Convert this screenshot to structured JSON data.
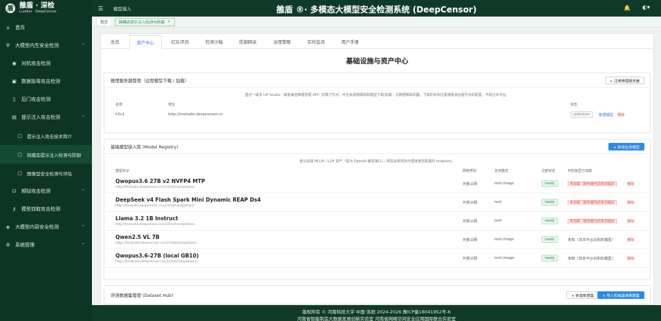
{
  "brand": {
    "name": "雒盾 · 深检",
    "sub": "Luodun · DeepCensor"
  },
  "topbar": {
    "breadcrumb": "模型接入",
    "system_title": "雒盾 ®· 多模态大模型安全检测系统 (DeepCensor)"
  },
  "sidebar": {
    "items": [
      {
        "label": "首页",
        "icon": "home-icon",
        "level": 1
      },
      {
        "label": "大模型内生安全检测",
        "icon": "shield-icon",
        "level": 1,
        "chev": "⌃"
      },
      {
        "label": "对抗攻击检测",
        "icon": "target-icon",
        "level": 2
      },
      {
        "label": "数据投毒攻击检测",
        "icon": "database-icon",
        "level": 2
      },
      {
        "label": "后门攻击检测",
        "icon": "door-icon",
        "level": 2
      },
      {
        "label": "提示注入攻击检测",
        "icon": "prompt-icon",
        "level": 2,
        "chev": "⌃"
      },
      {
        "label": "提示注入攻击技术简介",
        "icon": "doc-icon",
        "level": 3
      },
      {
        "label": "跨模态提示注入检测与防御",
        "icon": "doc-icon",
        "level": 3,
        "active": true
      },
      {
        "label": "图像型安全检测与评估",
        "icon": "doc-icon",
        "level": 3
      },
      {
        "label": "越狱攻击检测",
        "icon": "lock-icon",
        "level": 2,
        "chev": "⌃"
      },
      {
        "label": "模型窃取攻击检测",
        "icon": "key-icon",
        "level": 2
      },
      {
        "label": "大模型内容安全检测",
        "icon": "content-icon",
        "level": 1,
        "chev": "⌃"
      },
      {
        "label": "系统管理",
        "icon": "gear-icon",
        "level": 1,
        "chev": "⌃"
      }
    ]
  },
  "page_tabs": [
    {
      "label": "首页",
      "active": false
    },
    {
      "label": "跨模态提示注入检测与防御",
      "active": true
    }
  ],
  "subtabs": [
    "总览",
    "资产中心",
    "红队评测",
    "检测沙箱",
    "防御网关",
    "治理策略",
    "实时监测",
    "用户手册"
  ],
  "active_subtab": "资产中心",
  "page_title": "基础设施与资产中心",
  "inference": {
    "title": "推理服务器管理（远程模型下载 / 加载）",
    "btn": "+ 注册推理服务器",
    "note": "登记一或多 LM Studio（或者兼容推理管理 API）的算力节点，可在资源明细获取模型下载/加载、元数据等除机器。下载的实际位置遵循该远程节点的配置，不经过本平台。",
    "cols": [
      "名称",
      "地址",
      "状态"
    ],
    "rows": [
      {
        "name": "h5c1",
        "addr": "http://lmstudio.deepcensor.cn",
        "status": "unknown",
        "manage": "管理模型",
        "del": "删除"
      }
    ]
  },
  "registry": {
    "title": "基础模型接入库 (Model Registry)",
    "btn": "+ 新增业务模型",
    "note": "登记后端 MLLM / LLM 资产（需为 OpenAI 兼容接口）；网关会将实际代理连接至配置的 endpoint。",
    "cols": [
      "模型标识",
      "网络类别",
      "支持模态",
      "注册状态",
      "布防能否已加载"
    ],
    "rows": [
      {
        "name": "Qwopus3.6 27B v2 NVFP4 MTP",
        "url": "http://lmstudio.deepcensor.cn/v1/chat/completions",
        "net": "外部公网",
        "mod": "text,image",
        "status": "ready",
        "load": "未加载（服务器当前未加载此",
        "load_warn": true,
        "del": "删除"
      },
      {
        "name": "DeepSeek v4 Flash Spark Mini Dynamic REAP Ds4",
        "url": "http://lmstudio.deepcensor.cn/v1/chat/completions",
        "net": "外部公网",
        "mod": "text",
        "status": "ready",
        "load": "未加载（服务器当前未加载此",
        "load_warn": true,
        "del": "删除"
      },
      {
        "name": "Llama 3.2 1B Instruct",
        "url": "http://lmstudio.deepcensor.cn/v1/chat/completions",
        "net": "外部公网",
        "mod": "text",
        "status": "ready",
        "load": "未加载（服务器当前未加载此",
        "load_warn": true,
        "del": "删除"
      },
      {
        "name": "Qwen2.5 VL 7B",
        "url": "https://lmstudio.deepcensor.cn/v1/chat/completions",
        "net": "外部公网",
        "mod": "text,image",
        "status": "ready",
        "load": "未知（非本平台识别的模型）",
        "load_warn": false,
        "del": "删除"
      },
      {
        "name": "Qwopus3.6-27B (local GB10)",
        "url": "https://lmstudio.deepcensor.cn/v1/chat/completions",
        "net": "外部公网",
        "mod": "text,image",
        "status": "ready",
        "load": "未知（非本平台识别的模型）",
        "load_warn": false,
        "del": "删除"
      }
    ]
  },
  "dataset": {
    "title": "评测数据集管理 (Dataset Hub)",
    "btn_new": "+ 新建数据集",
    "btn_import": "+ 导入权威基准数据集"
  },
  "footer": {
    "line1": "版权所有 © 河南科技大学  中国·洛阳  2024-2026    豫ICP备18041952号-6",
    "line2": "河南省智能制造大数据发展创新实验室  河南省网络空间安全应用国际联合实验室"
  }
}
